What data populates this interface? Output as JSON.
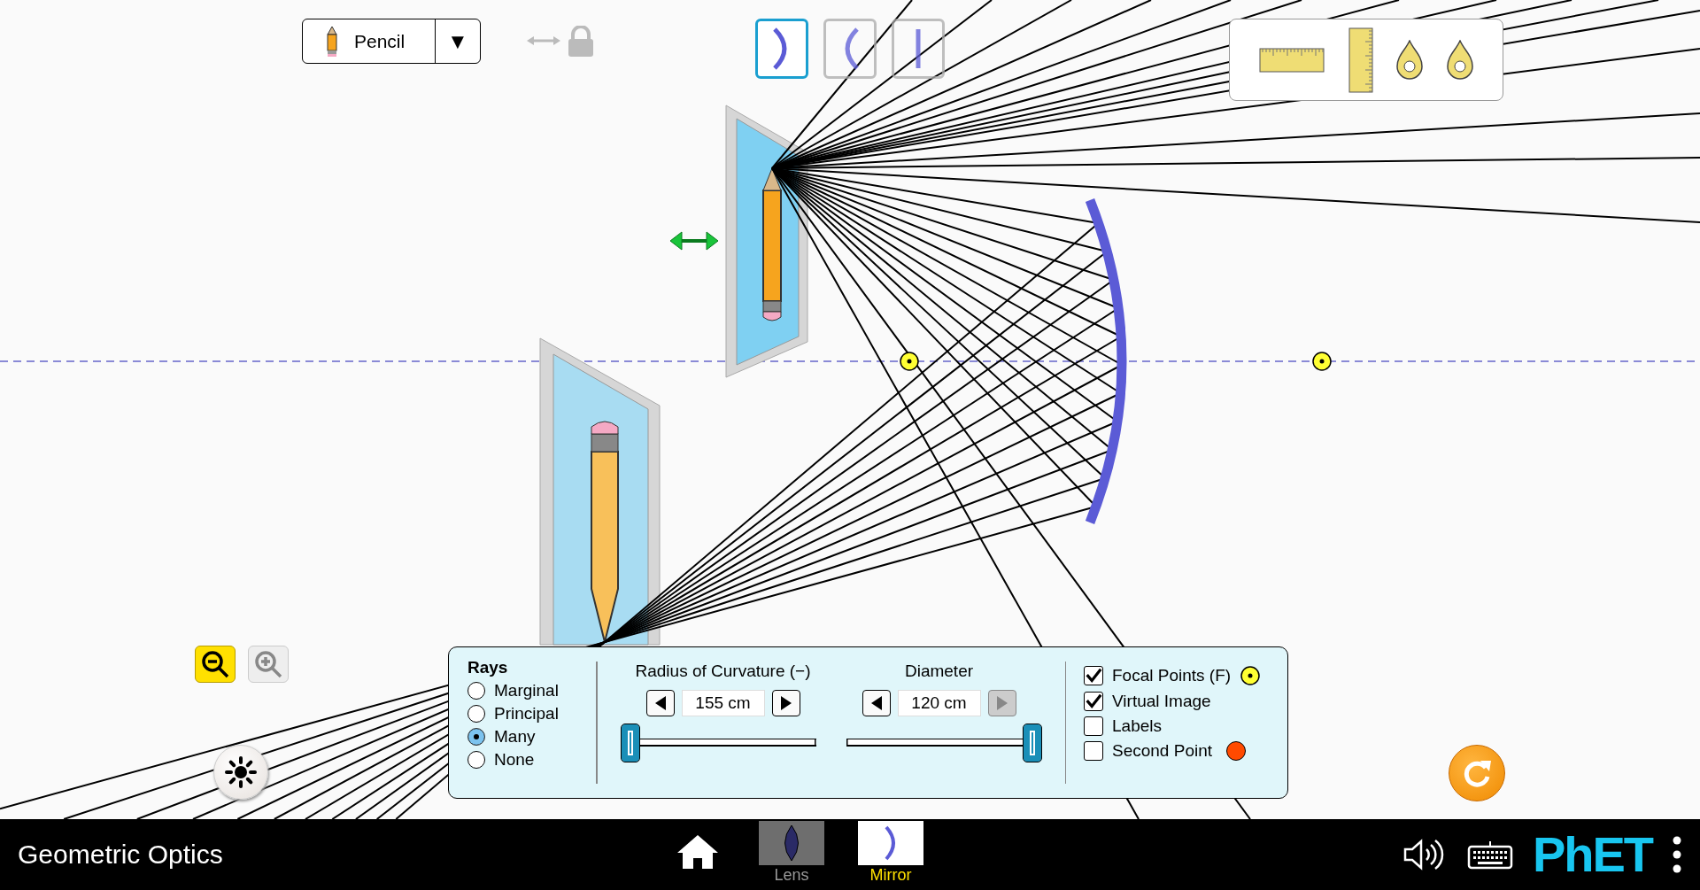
{
  "object_selector": {
    "label": "Pencil",
    "arrow": "▼"
  },
  "mirror_types": [
    {
      "selected": true
    },
    {
      "selected": false
    },
    {
      "selected": false
    }
  ],
  "zoom": {
    "out_disabled": false,
    "in_disabled": true
  },
  "control_panel": {
    "rays": {
      "title": "Rays",
      "options": [
        {
          "label": "Marginal",
          "selected": false
        },
        {
          "label": "Principal",
          "selected": false
        },
        {
          "label": "Many",
          "selected": true
        },
        {
          "label": "None",
          "selected": false
        }
      ]
    },
    "sliders": [
      {
        "label": "Radius of Curvature (−)",
        "value": "155 cm",
        "level": 0,
        "decrease_disabled": false,
        "increase_disabled": false
      },
      {
        "label": "Diameter",
        "value": "120 cm",
        "level": 1,
        "decrease_disabled": false,
        "increase_disabled": true
      }
    ],
    "checkboxes": [
      {
        "label": "Focal Points (F)",
        "checked": true,
        "kind": "focal"
      },
      {
        "label": "Virtual Image",
        "checked": true,
        "kind": "plain"
      },
      {
        "label": "Labels",
        "checked": false,
        "kind": "plain"
      },
      {
        "label": "Second Point",
        "checked": false,
        "kind": "point",
        "color": "#ff4a00"
      }
    ]
  },
  "navbar": {
    "title": "Geometric Optics",
    "screens": [
      {
        "label": "Lens",
        "selected": false,
        "kind": "lens"
      },
      {
        "label": "Mirror",
        "selected": true,
        "kind": "mirror"
      }
    ],
    "logo": "PhET"
  }
}
